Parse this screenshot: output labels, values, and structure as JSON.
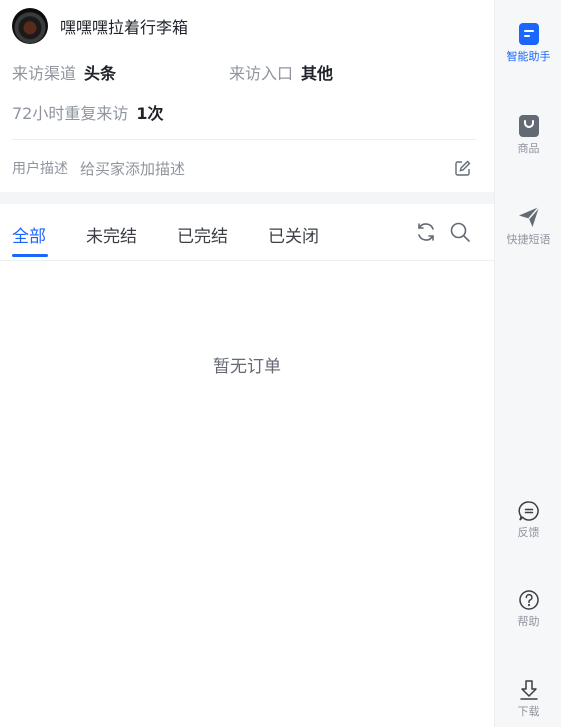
{
  "user": {
    "name": "嘿嘿嘿拉着行李箱"
  },
  "visit": {
    "channel_label": "来访渠道",
    "channel_value": "头条",
    "entry_label": "来访入口",
    "entry_value": "其他",
    "repeat_label": "72小时重复来访",
    "repeat_value": "1次"
  },
  "description": {
    "label": "用户描述",
    "placeholder": "给买家添加描述"
  },
  "order_tabs": {
    "items": [
      {
        "label": "全部",
        "active": true
      },
      {
        "label": "未完结",
        "active": false
      },
      {
        "label": "已完结",
        "active": false
      },
      {
        "label": "已关闭",
        "active": false
      }
    ]
  },
  "orders": {
    "empty_text": "暂无订单"
  },
  "sidebar": {
    "items": [
      {
        "label": "智能助手",
        "icon": "assistant-icon",
        "active": true
      },
      {
        "label": "商品",
        "icon": "product-bag-icon",
        "active": false
      },
      {
        "label": "快捷短语",
        "icon": "send-paper-plane-icon",
        "active": false
      },
      {
        "label": "反馈",
        "icon": "feedback-icon",
        "active": false
      },
      {
        "label": "帮助",
        "icon": "help-icon",
        "active": false
      },
      {
        "label": "下载",
        "icon": "download-icon",
        "active": false
      }
    ]
  },
  "colors": {
    "accent": "#1a66ff",
    "sidebar_bg": "#f6f7f9",
    "muted_text": "#8f959e"
  }
}
